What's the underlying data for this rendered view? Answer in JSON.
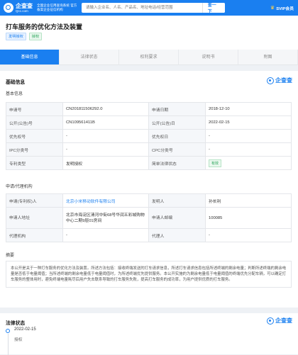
{
  "topbar": {
    "logo_name": "企查查",
    "logo_domain": "Qcc.com",
    "tagline": "全国企业信用查询系统 官方备案企业征信机构",
    "search_placeholder": "请输入企业名、人名、产品名、地址电话/经营范围",
    "search_button": "查一下",
    "svip": "SVIP会员"
  },
  "header": {
    "title": "打车服务的优化方法及装置",
    "tags": [
      "发明授权",
      "授权"
    ]
  },
  "tabs": [
    "基础信息",
    "法律状态",
    "权利要求",
    "说明书",
    "附图"
  ],
  "active_tab": 0,
  "basic": {
    "section_title": "基础信息",
    "sub_title": "基本信息",
    "watermark": "企查查",
    "rows": [
      [
        "申请号",
        "CN201811506292.0",
        "申请日期",
        "2018-12-10"
      ],
      [
        "公开(公告)号",
        "CN109561411B",
        "公开(公告)日",
        "2022-02-15"
      ],
      [
        "优先权号",
        "-",
        "优先权日",
        "-"
      ],
      [
        "IPC分类号",
        "-",
        "CPC分类号",
        "-"
      ],
      [
        "专利类型",
        "发明授权",
        "简单法律状态",
        "有效"
      ]
    ]
  },
  "applicant": {
    "sub_title": "申请/代理机构",
    "rows": [
      [
        "申请(专利权)人",
        "北京小米移动软件有限公司",
        "发明人",
        "孙长利"
      ],
      [
        "申请人地址",
        "北京市海淀区清河中街68号华润五彩城购物中心二期9层01房间",
        "申请人邮编",
        "100085"
      ],
      [
        "代理机构",
        "-",
        "代理人",
        "-"
      ]
    ]
  },
  "abstract": {
    "title": "摘要",
    "text": "本公开是关于一种打车服务的优化方法及装置。所述方法包括：接收终端发送的打车请求信息，所述打车请求信息包括所述终端的剩余电量；判断所述终端的剩余电量是否低于电量阈值；当所述终端的剩余电量低于电量阈值时，为所述终端优先提供服务。本公开实施的为剩余电量低于电量阈值的终端优先分配车辆，可以确定打车服务的整体用时，避免终端电量耗尽后用户失去联系导致的打车服务失败，提高打车服务的成功率，为用户提供优质的打车服务。"
  },
  "legal": {
    "title": "法律状态",
    "events": [
      {
        "date": "2022-02-15",
        "status": "授权"
      }
    ]
  }
}
